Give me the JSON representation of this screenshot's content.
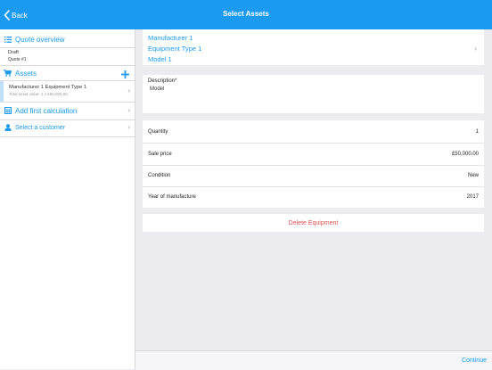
{
  "navbar": {
    "back_label": "Back",
    "title": "Select Assets"
  },
  "sidebar": {
    "quote_overview_label": "Quote overview",
    "status": "Draft",
    "quote_number": "Quote #1",
    "assets_label": "Assets",
    "asset_item": {
      "title": "Manufacturer 1 Equipment Type 1",
      "subtitle": "Total asset value: 1 x £50,000.00"
    },
    "calculation_label": "Add first calculation",
    "customer_label": "Select a customer"
  },
  "asset_header": {
    "manufacturer": "Manufacturer 1",
    "equipment_type": "Equipment Type 1",
    "model": "Model 1"
  },
  "description": {
    "label": "Description*",
    "value": "Model"
  },
  "details": [
    {
      "label": "Quantity",
      "value": "1"
    },
    {
      "label": "Sale price",
      "value": "£50,000.00"
    },
    {
      "label": "Condition",
      "value": "New"
    },
    {
      "label": "Year of manufacture",
      "value": "2017"
    }
  ],
  "delete_label": "Delete Equipment",
  "continue_label": "Continue",
  "colors": {
    "accent": "#1a9af0",
    "danger": "#d9534f",
    "background": "#ebebf0"
  },
  "icons": [
    "chevron-left-icon",
    "list-icon",
    "cart-icon",
    "plus-icon",
    "calculator-icon",
    "user-icon",
    "chevron-right-icon"
  ]
}
